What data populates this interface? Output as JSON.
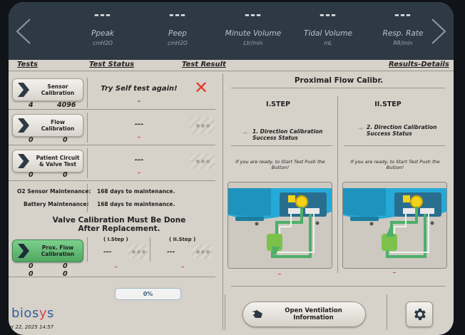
{
  "header": {
    "params": [
      {
        "value": "---",
        "name": "Ppeak",
        "unit": "cmH2O"
      },
      {
        "value": "---",
        "name": "Peep",
        "unit": "cmH2O"
      },
      {
        "value": "---",
        "name": "Minute Volume",
        "unit": "Ltr/min"
      },
      {
        "value": "---",
        "name": "Tidal Volume",
        "unit": "mL"
      },
      {
        "value": "---",
        "name": "Resp. Rate",
        "unit": "RR/min"
      }
    ]
  },
  "columns": {
    "tests": "Tests",
    "status": "Test Status",
    "result": "Test Result",
    "details": "Results-Details"
  },
  "tests": [
    {
      "label": "Sensor Calibration",
      "num1": "4",
      "num2": "4096",
      "status": "Try Self test again!",
      "dash": "–"
    },
    {
      "label": "Flow Calibration",
      "num1": "0",
      "num2": "0",
      "status": "---",
      "dash": "–"
    },
    {
      "label": "Patient Circuit & Valve Test",
      "num1": "0",
      "num2": "0",
      "status": "---",
      "dash": "–"
    }
  ],
  "maintenance": {
    "o2_label": "O2 Sensor Maintenance:",
    "o2_value": "168 days to maintenance.",
    "battery_label": "Battery Maintenance:",
    "battery_value": "168 days to maintenance."
  },
  "valve_message": "Valve Calibration Must Be Done After Replacement.",
  "prox": {
    "label": "Prox. Flow Calibration",
    "step1": "( I.Step )",
    "step2": "( II.Step )",
    "val1": "---",
    "val2": "---",
    "nums": [
      "0",
      "0",
      "0",
      "0"
    ]
  },
  "progress": "0%",
  "logo": {
    "a": "bios",
    "b": "y",
    "c": "s"
  },
  "datetime": "pr 22, 2025  14:57",
  "right_panel": {
    "title": "Proximal Flow Calibr.",
    "step1": {
      "title": "I.STEP",
      "direction": "1. Direction Calibration Success Status",
      "ready": "If you are ready, to Start Test Push the Button!"
    },
    "step2": {
      "title": "II.STEP",
      "direction": "2. Direction Calibration Success Status",
      "ready": "If you are ready, to Start Test Push the Button!"
    }
  },
  "open_button": "Open Ventilation Information",
  "colors": {
    "header": "#2d3a45",
    "panel": "#d6d1c9",
    "green_button": "#5cb86e",
    "error_red": "#e23a2a",
    "diagram_blue": "#25a9d6",
    "diagram_green": "#4caf6a"
  }
}
